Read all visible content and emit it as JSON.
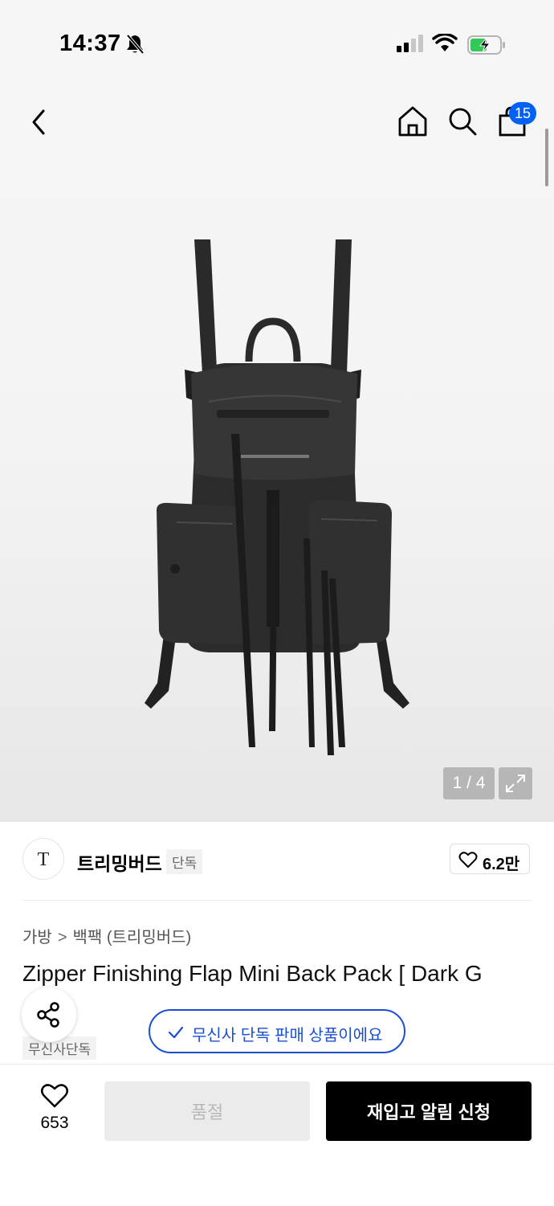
{
  "status_bar": {
    "time": "14:37",
    "battery_color": "#34c759"
  },
  "nav": {
    "cart_count": "15",
    "badge_color": "#0062f5"
  },
  "image": {
    "page_indicator": "1 / 4",
    "total_images": 4,
    "current_image": 1
  },
  "brand": {
    "logo_text": "T",
    "name": "트리밍버드",
    "tag": "단독",
    "likes": "6.2만"
  },
  "breadcrumb": {
    "category": "가방",
    "subcategory": "백팩 (트리밍버드)"
  },
  "product": {
    "title": "Zipper Finishing Flap Mini Back Pack [ Dark G",
    "exclusive_tag": "무신사단독",
    "exclusive_notice": "무신사 단독 판매 상품이에요",
    "accent_color": "#1b4fd1"
  },
  "bottom_bar": {
    "wish_count": "653",
    "soldout_label": "품절",
    "restock_label": "재입고 알림 신청"
  }
}
